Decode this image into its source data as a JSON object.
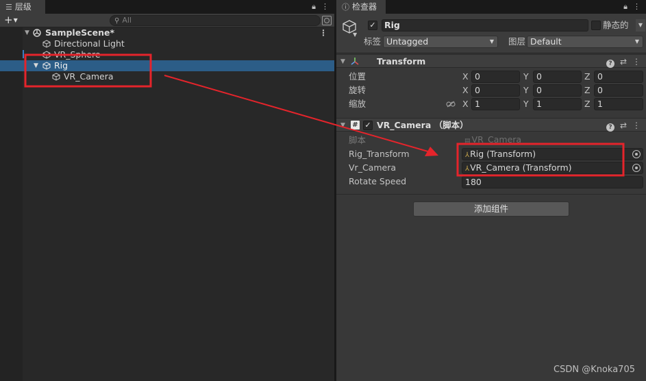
{
  "hierarchy": {
    "tab_label": "层级",
    "search_placeholder": "All",
    "scene_name": "SampleScene*",
    "items": [
      {
        "label": "Directional Light"
      },
      {
        "label": "VR_Sphere"
      },
      {
        "label": "Rig"
      },
      {
        "label": "VR_Camera"
      }
    ]
  },
  "inspector": {
    "tab_label": "检查器",
    "object_name": "Rig",
    "static_label": "静态的",
    "tag_label": "标签",
    "tag_value": "Untagged",
    "layer_label": "图层",
    "layer_value": "Default",
    "transform": {
      "title": "Transform",
      "position_label": "位置",
      "rotation_label": "旋转",
      "scale_label": "缩放",
      "position": {
        "x": "0",
        "y": "0",
        "z": "0"
      },
      "rotation": {
        "x": "0",
        "y": "0",
        "z": "0"
      },
      "scale": {
        "x": "1",
        "y": "1",
        "z": "1"
      },
      "axis_x": "X",
      "axis_y": "Y",
      "axis_z": "Z"
    },
    "script_component": {
      "title": "VR_Camera （脚本）",
      "script_label": "脚本",
      "script_value": "VR_Camera",
      "rig_transform_label": "Rig_Transform",
      "rig_transform_value": "Rig (Transform)",
      "vr_camera_label": "Vr_Camera",
      "vr_camera_value": "VR_Camera (Transform)",
      "rotate_speed_label": "Rotate Speed",
      "rotate_speed_value": "180"
    },
    "add_component_label": "添加组件"
  },
  "watermark": "CSDN @Knoka705",
  "colors": {
    "selection": "#2c5d87",
    "annotation_red": "#e5242b"
  }
}
